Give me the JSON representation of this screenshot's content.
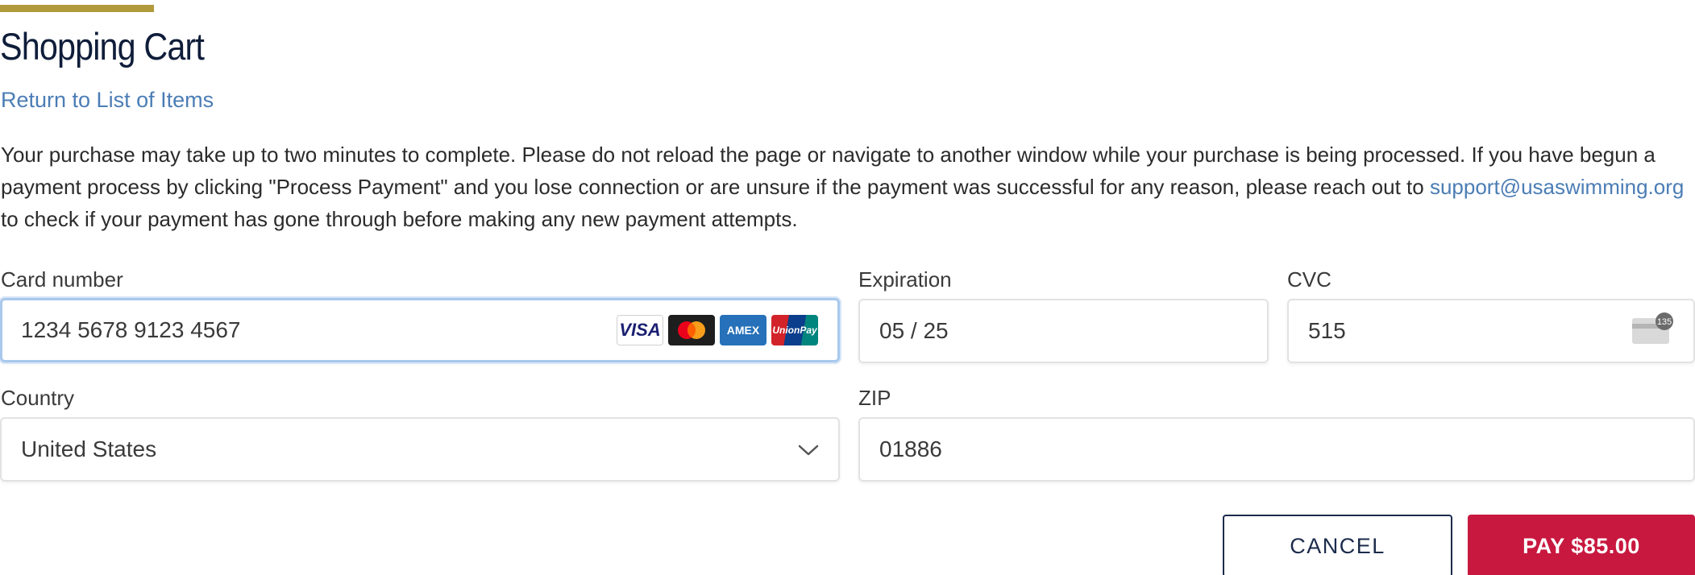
{
  "header": {
    "title": "Shopping Cart",
    "return_link": "Return to List of Items"
  },
  "notice": {
    "text_before": "Your purchase may take up to two minutes to complete. Please do not reload the page or navigate to another window while your purchase is being processed. If you have begun a payment process by clicking \"Process Payment\" and you lose connection or are unsure if the payment was successful for any reason, please reach out to ",
    "email": "support@usaswimming.org",
    "text_after": " to check if your payment has gone through before making any new payment attempts."
  },
  "form": {
    "card_number": {
      "label": "Card number",
      "value": "1234 5678 9123 4567",
      "brands": [
        "VISA",
        "mastercard",
        "AMEX",
        "UnionPay"
      ]
    },
    "expiration": {
      "label": "Expiration",
      "value": "05 / 25"
    },
    "cvc": {
      "label": "CVC",
      "value": "515",
      "icon": "card-cvc-icon",
      "icon_text": "135"
    },
    "country": {
      "label": "Country",
      "value": "United States"
    },
    "zip": {
      "label": "ZIP",
      "value": "01886"
    }
  },
  "actions": {
    "cancel_label": "CANCEL",
    "pay_label": "PAY $85.00"
  },
  "colors": {
    "accent_gold": "#b19a3b",
    "link_blue": "#4b7db5",
    "navy": "#1b2b4b",
    "pay_red": "#c8183f"
  }
}
